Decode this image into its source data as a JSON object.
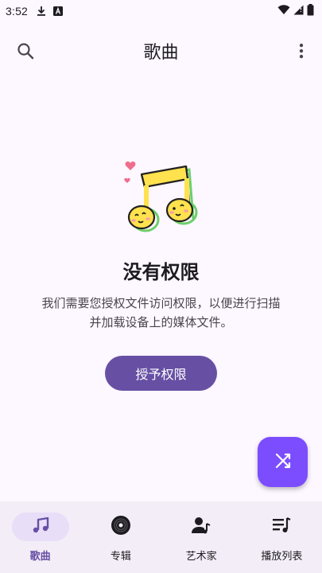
{
  "status_bar": {
    "time": "3:52",
    "icons": [
      "download-icon",
      "a-box-icon",
      "wifi-icon",
      "signal-icon",
      "battery-icon"
    ]
  },
  "app_bar": {
    "title": "歌曲",
    "search_icon": "search-icon",
    "more_icon": "more-vert-icon"
  },
  "empty_state": {
    "illustration": "music-note-faces-illustration",
    "title": "没有权限",
    "description": "我们需要您授权文件访问权限，以便进行扫描并加载设备上的媒体文件。",
    "button_label": "授予权限"
  },
  "fab": {
    "icon": "shuffle-icon"
  },
  "bottom_nav": {
    "items": [
      {
        "label": "歌曲",
        "icon": "music-note-icon",
        "active": true
      },
      {
        "label": "专辑",
        "icon": "album-icon",
        "active": false
      },
      {
        "label": "艺术家",
        "icon": "artist-icon",
        "active": false
      },
      {
        "label": "播放列表",
        "icon": "playlist-icon",
        "active": false
      }
    ]
  },
  "colors": {
    "background": "#fdf7ff",
    "primary": "#6750a4",
    "fab": "#7c4dff",
    "nav_background": "#f3edf7",
    "nav_active_pill": "#e8def8"
  }
}
